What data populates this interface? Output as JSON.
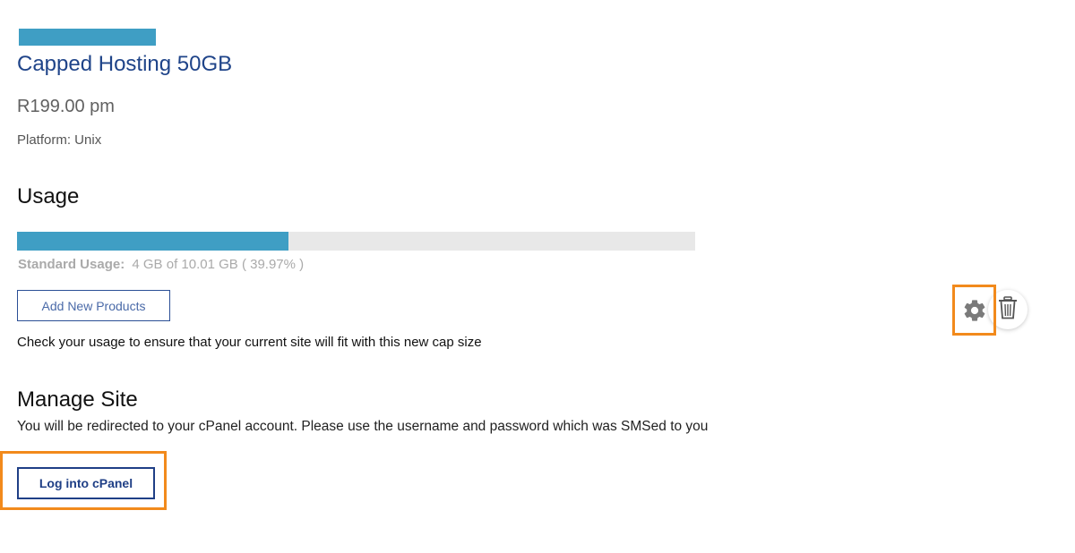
{
  "product": {
    "title": "Capped Hosting 50GB",
    "price": "R199.00 pm",
    "platform": "Platform: Unix",
    "accent_color": "#3f9ec4"
  },
  "usage": {
    "heading": "Usage",
    "label": "Standard Usage:",
    "detail": "4 GB of 10.01 GB ( 39.97% )",
    "percent": 39.97,
    "add_button_label": "Add New Products",
    "note": "Check your usage to ensure that your current site will fit with this new cap size"
  },
  "actions": {
    "settings_icon": "gear-icon",
    "delete_icon": "trash-icon",
    "highlight_color": "#f28a1c"
  },
  "manage": {
    "heading": "Manage Site",
    "description": "You will be redirected to your cPanel account. Please use the username and password which was SMSed to you",
    "login_button_label": "Log into cPanel"
  }
}
